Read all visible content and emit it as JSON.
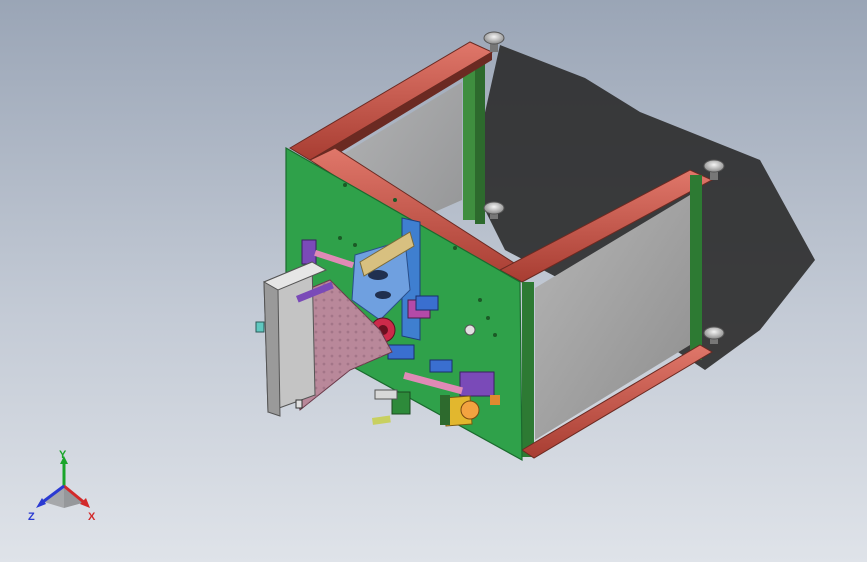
{
  "viewport": {
    "background_top": "#9aa5b6",
    "background_bottom": "#dfe3e9"
  },
  "model": {
    "colors": {
      "frame_profile": "#c8584a",
      "mount_plate": "#2fa14a",
      "window_panel": "#9c9c9c",
      "cover_plate": "#b9889a",
      "blue_plate": "#3f7fd0",
      "purple_block": "#7a4ab8",
      "yellow_block": "#e2b72e",
      "shadow": "#2b2b2b"
    }
  },
  "triad": {
    "x_label": "X",
    "y_label": "Y",
    "z_label": "Z",
    "colors": {
      "x": "#d22a2a",
      "y": "#1aa52a",
      "z": "#2a3ad2"
    },
    "icon": "coordinate-triad-icon"
  }
}
